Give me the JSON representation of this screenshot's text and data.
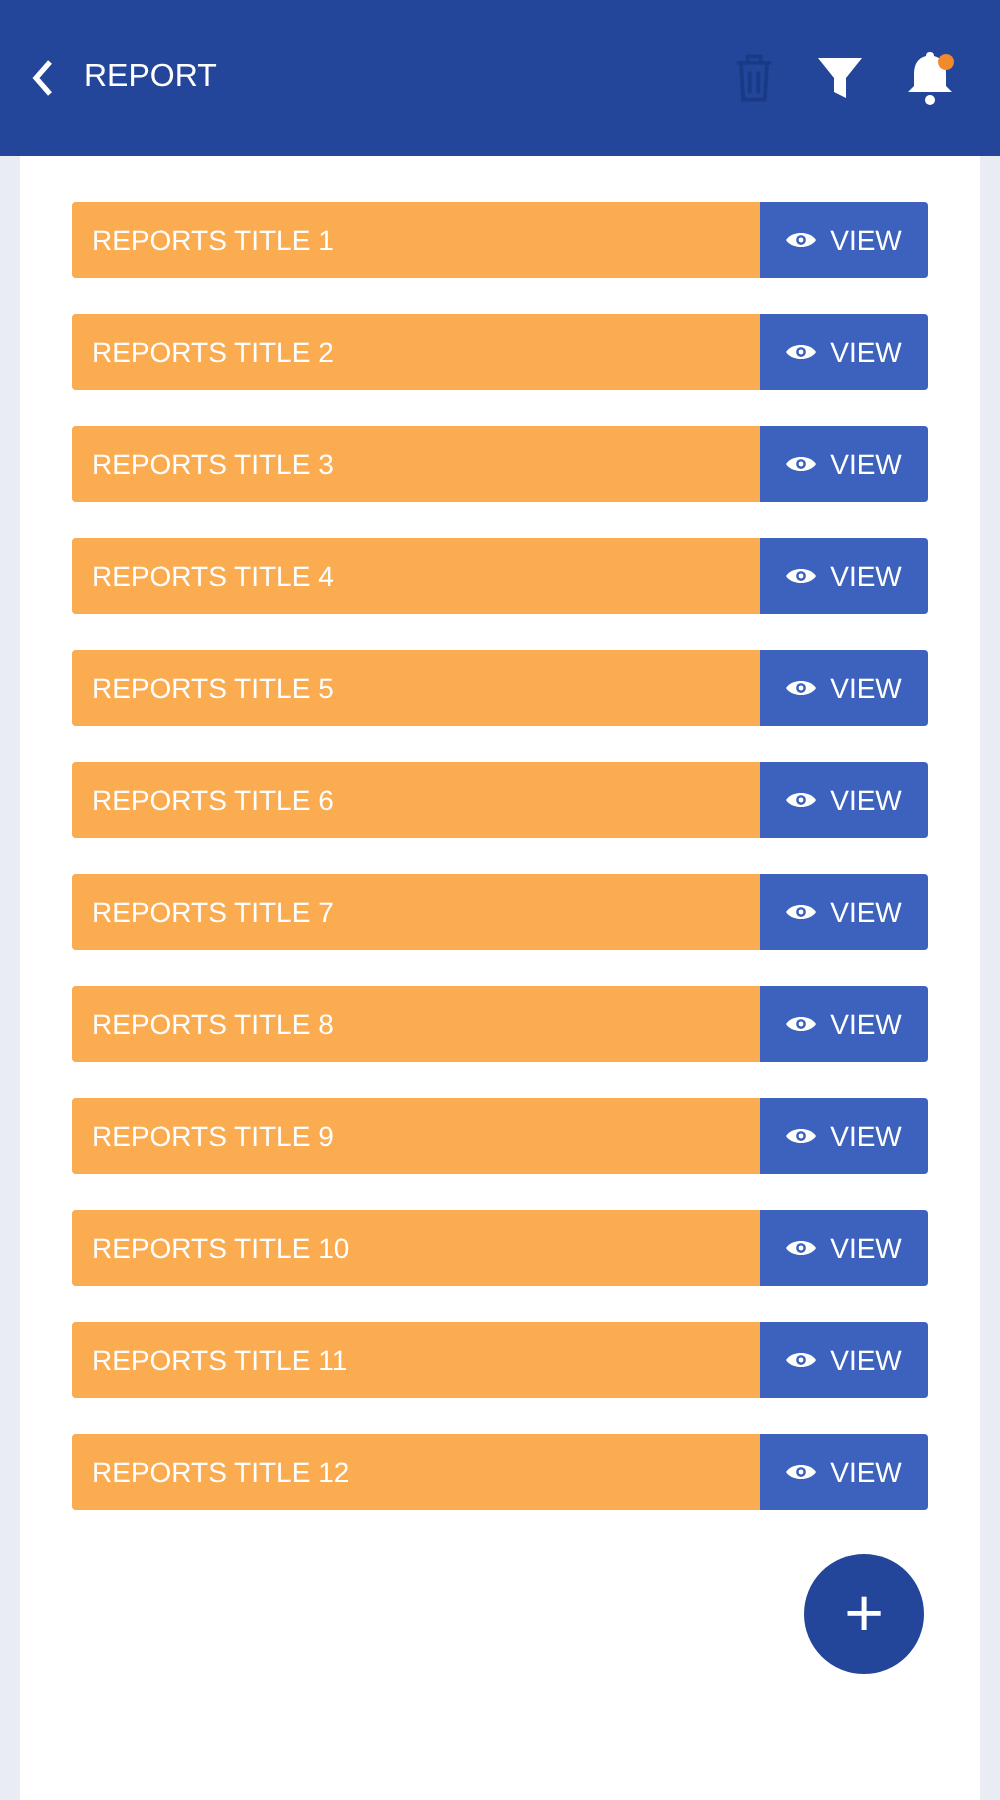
{
  "header": {
    "title": "REPORT",
    "delete_disabled": true,
    "notification_unread": true
  },
  "reports": [
    {
      "title": "REPORTS TITLE 1",
      "action": "VIEW"
    },
    {
      "title": "REPORTS TITLE 2",
      "action": "VIEW"
    },
    {
      "title": "REPORTS TITLE 3",
      "action": "VIEW"
    },
    {
      "title": "REPORTS TITLE 4",
      "action": "VIEW"
    },
    {
      "title": "REPORTS TITLE 5",
      "action": "VIEW"
    },
    {
      "title": "REPORTS TITLE 6",
      "action": "VIEW"
    },
    {
      "title": "REPORTS TITLE 7",
      "action": "VIEW"
    },
    {
      "title": "REPORTS TITLE 8",
      "action": "VIEW"
    },
    {
      "title": "REPORTS TITLE 9",
      "action": "VIEW"
    },
    {
      "title": "REPORTS TITLE 10",
      "action": "VIEW"
    },
    {
      "title": "REPORTS TITLE 11",
      "action": "VIEW"
    },
    {
      "title": "REPORTS TITLE 12",
      "action": "VIEW"
    }
  ],
  "fab": "+"
}
